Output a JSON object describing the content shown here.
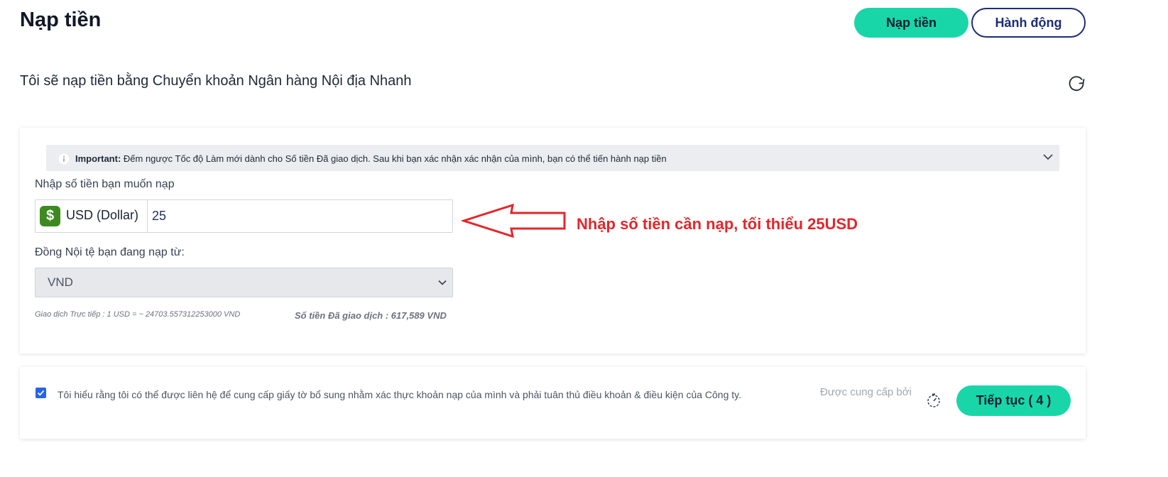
{
  "header": {
    "title": "Nạp tiền",
    "deposit_button": "Nạp tiền",
    "actions_button": "Hành động"
  },
  "method": {
    "text": "Tôi sẽ nạp tiền bằng Chuyển khoản Ngân hàng Nội địa Nhanh"
  },
  "notice": {
    "label": "Important:",
    "text": " Đếm ngược Tốc độ Làm mới dành cho Số tiền Đã giao dịch. Sau khi bạn xác nhận xác nhận của mình, bạn có thể tiến hành nạp tiền"
  },
  "amount": {
    "label": "Nhập số tiền bạn muốn nạp",
    "currency_symbol": "$",
    "currency": "USD (Dollar)",
    "value": "25"
  },
  "annotation": {
    "text": "Nhập số tiền cần nạp, tối thiểu 25USD",
    "color": "#e3262b"
  },
  "local_currency": {
    "label": "Đồng Nội tệ bạn đang nạp từ:",
    "selected": "VND"
  },
  "rate": {
    "text": "Giao dịch Trực tiếp : 1 USD = ~ 24703.557312253000 VND",
    "converted": "Số tiền Đã giao dịch : 617,589 VND"
  },
  "footer": {
    "agree_text": "Tôi hiểu rằng tôi có thể được liên hệ để cung cấp giấy tờ bổ sung nhằm xác thực khoản nạp của mình và phải tuân thủ điều khoản & điều kiện của Công ty.",
    "provided_by": "Được cung cấp bởi",
    "continue_button": "Tiếp tục ( 4 )"
  },
  "colors": {
    "accent": "#19d6a8",
    "navy": "#1d2d75",
    "checkbox": "#2563eb"
  }
}
